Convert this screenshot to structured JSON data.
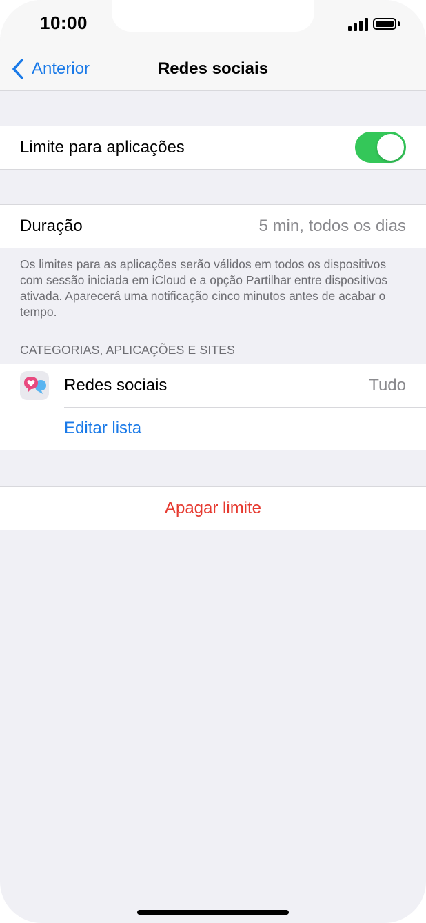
{
  "status_bar": {
    "time": "10:00"
  },
  "nav": {
    "back_label": "Anterior",
    "title": "Redes sociais"
  },
  "limit": {
    "label": "Limite para aplicações",
    "enabled": true
  },
  "duration": {
    "label": "Duração",
    "value": "5 min, todos os dias"
  },
  "note": "Os limites para as aplicações serão válidos em todos os dispositivos com sessão iniciada em iCloud e a opção Partilhar entre dispositivos ativada. Aparecerá uma notificação cinco minutos antes de acabar o tempo.",
  "section": {
    "header": "CATEGORIAS, APLICAÇÕES E SITES",
    "category": {
      "label": "Redes sociais",
      "value": "Tudo",
      "icon": "social-networks-icon"
    },
    "edit_label": "Editar lista"
  },
  "delete_label": "Apagar limite",
  "colors": {
    "accent": "#1a7ae8",
    "toggle_on": "#34c759",
    "destructive": "#e6392f",
    "background": "#f0f0f5"
  }
}
